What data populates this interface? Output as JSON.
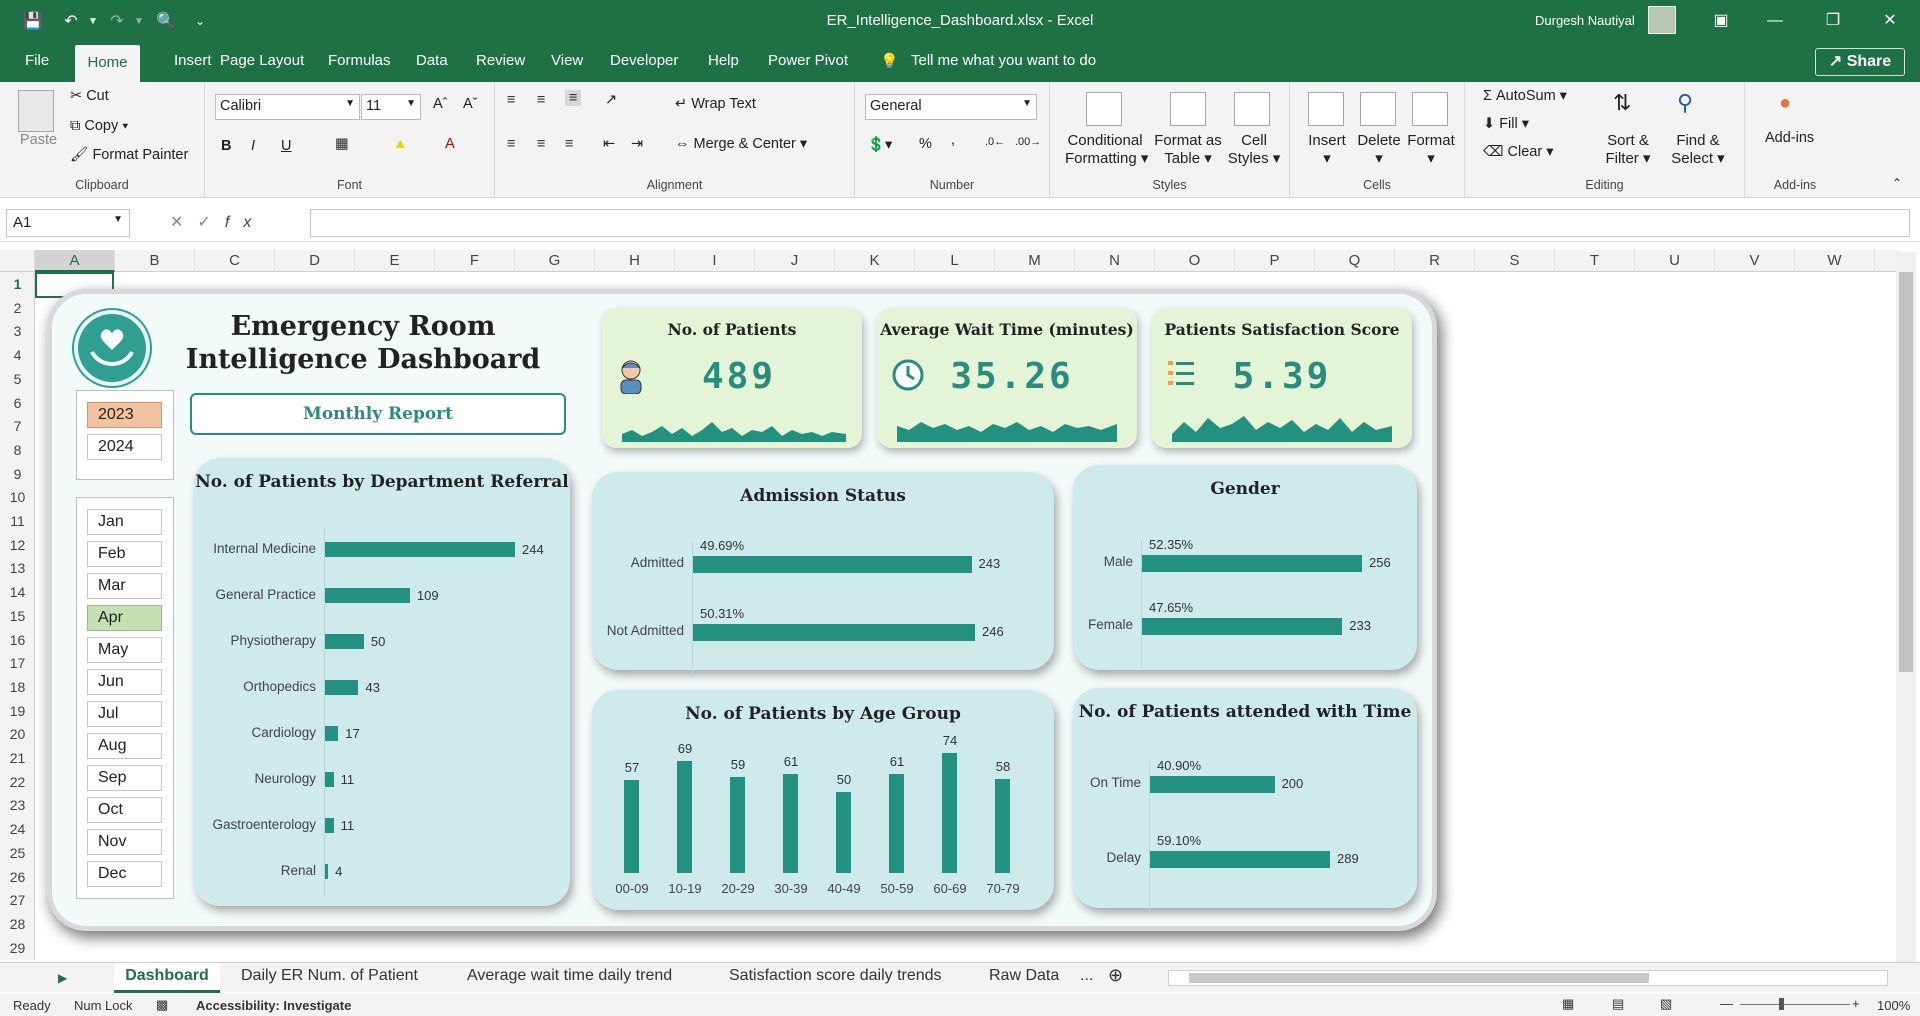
{
  "window": {
    "title": "ER_Intelligence_Dashboard.xlsx - Excel",
    "user": "Durgesh Nautiyal",
    "share_label": "Share"
  },
  "menu": [
    "File",
    "Home",
    "Insert",
    "Page Layout",
    "Formulas",
    "Data",
    "Review",
    "View",
    "Developer",
    "Help",
    "Power Pivot"
  ],
  "tell_me": "Tell me what you want to do",
  "ribbon": {
    "clipboard": {
      "label": "Clipboard",
      "paste": "Paste",
      "cut": "Cut",
      "copy": "Copy",
      "format_painter": "Format Painter"
    },
    "font": {
      "label": "Font",
      "name": "Calibri",
      "size": "11",
      "bold": "B",
      "italic": "I",
      "underline": "U"
    },
    "alignment": {
      "label": "Alignment",
      "wrap": "Wrap Text",
      "merge": "Merge & Center"
    },
    "number": {
      "label": "Number",
      "format": "General",
      "percent": "%",
      "comma": ","
    },
    "styles": {
      "label": "Styles",
      "conditional_1": "Conditional",
      "conditional_2": "Formatting",
      "format_table_1": "Format as",
      "format_table_2": "Table",
      "cell_styles_1": "Cell",
      "cell_styles_2": "Styles"
    },
    "cells": {
      "label": "Cells",
      "insert": "Insert",
      "delete": "Delete",
      "format": "Format"
    },
    "editing": {
      "label": "Editing",
      "autosum": "AutoSum",
      "fill": "Fill",
      "clear": "Clear",
      "sort_1": "Sort &",
      "sort_2": "Filter",
      "find_1": "Find &",
      "find_2": "Select"
    },
    "addins": {
      "label": "Add-ins",
      "addins": "Add-ins"
    }
  },
  "formula_bar": {
    "name_box": "A1",
    "fx": "fx",
    "value": ""
  },
  "columns": [
    "A",
    "B",
    "C",
    "D",
    "E",
    "F",
    "G",
    "H",
    "I",
    "J",
    "K",
    "L",
    "M",
    "N",
    "O",
    "P",
    "Q",
    "R",
    "S",
    "T",
    "U",
    "V",
    "W"
  ],
  "rows": [
    "1",
    "2",
    "3",
    "4",
    "5",
    "6",
    "7",
    "8",
    "9",
    "10",
    "11",
    "12",
    "13",
    "14",
    "15",
    "16",
    "17",
    "18",
    "19",
    "20",
    "21",
    "22",
    "23",
    "24",
    "25",
    "26",
    "27",
    "28",
    "29"
  ],
  "dashboard": {
    "title": "Emergency Room Intelligence Dashboard",
    "monthly_report": "Monthly Report",
    "years": [
      {
        "label": "2023",
        "selected": true
      },
      {
        "label": "2024",
        "selected": false
      }
    ],
    "months": [
      {
        "label": "Jan",
        "selected": false
      },
      {
        "label": "Feb",
        "selected": false
      },
      {
        "label": "Mar",
        "selected": false
      },
      {
        "label": "Apr",
        "selected": true
      },
      {
        "label": "May",
        "selected": false
      },
      {
        "label": "Jun",
        "selected": false
      },
      {
        "label": "Jul",
        "selected": false
      },
      {
        "label": "Aug",
        "selected": false
      },
      {
        "label": "Sep",
        "selected": false
      },
      {
        "label": "Oct",
        "selected": false
      },
      {
        "label": "Nov",
        "selected": false
      },
      {
        "label": "Dec",
        "selected": false
      }
    ],
    "kpis": [
      {
        "title": "No. of Patients",
        "value": "489",
        "icon": "patient-icon"
      },
      {
        "title": "Average Wait Time (minutes)",
        "value": "35.26",
        "icon": "clock-icon"
      },
      {
        "title": "Patients Satisfaction Score",
        "value": "5.39",
        "icon": "list-icon"
      }
    ],
    "colors": {
      "accent": "#23917f",
      "card": "#cfeaea",
      "kpi": "#e3f5d6",
      "year_selected": "#f2c3a0",
      "month_selected": "#c6e0b4"
    }
  },
  "chart_data": [
    {
      "type": "bar",
      "title": "No. of Patients by Department Referral",
      "orientation": "horizontal",
      "categories": [
        "Internal Medicine",
        "General Practice",
        "Physiotherapy",
        "Orthopedics",
        "Cardiology",
        "Neurology",
        "Gastroenterology",
        "Renal"
      ],
      "values": [
        244,
        109,
        50,
        43,
        17,
        11,
        11,
        4
      ]
    },
    {
      "type": "bar",
      "title": "Admission Status",
      "orientation": "horizontal",
      "categories": [
        "Admitted",
        "Not Admitted"
      ],
      "values": [
        243,
        246
      ],
      "percent_labels": [
        "49.69%",
        "50.31%"
      ]
    },
    {
      "type": "bar",
      "title": "Gender",
      "orientation": "horizontal",
      "categories": [
        "Male",
        "Female"
      ],
      "values": [
        256,
        233
      ],
      "percent_labels": [
        "52.35%",
        "47.65%"
      ]
    },
    {
      "type": "bar",
      "title": "No. of Patients by Age Group",
      "orientation": "vertical",
      "categories": [
        "00-09",
        "10-19",
        "20-29",
        "30-39",
        "40-49",
        "50-59",
        "60-69",
        "70-79"
      ],
      "values": [
        57,
        69,
        59,
        61,
        50,
        61,
        74,
        58
      ]
    },
    {
      "type": "bar",
      "title": "No. of Patients attended with Time",
      "orientation": "horizontal",
      "categories": [
        "On Time",
        "Delay"
      ],
      "values": [
        200,
        289
      ],
      "percent_labels": [
        "40.90%",
        "59.10%"
      ]
    }
  ],
  "sheets": [
    {
      "label": "Dashboard",
      "active": true
    },
    {
      "label": "Daily ER Num. of Patient",
      "active": false
    },
    {
      "label": "Average wait time daily trend",
      "active": false
    },
    {
      "label": "Satisfaction score daily trends",
      "active": false
    },
    {
      "label": "Raw Data",
      "active": false
    }
  ],
  "status": {
    "ready": "Ready",
    "numlock": "Num Lock",
    "accessibility": "Accessibility: Investigate",
    "zoom": "100%"
  }
}
